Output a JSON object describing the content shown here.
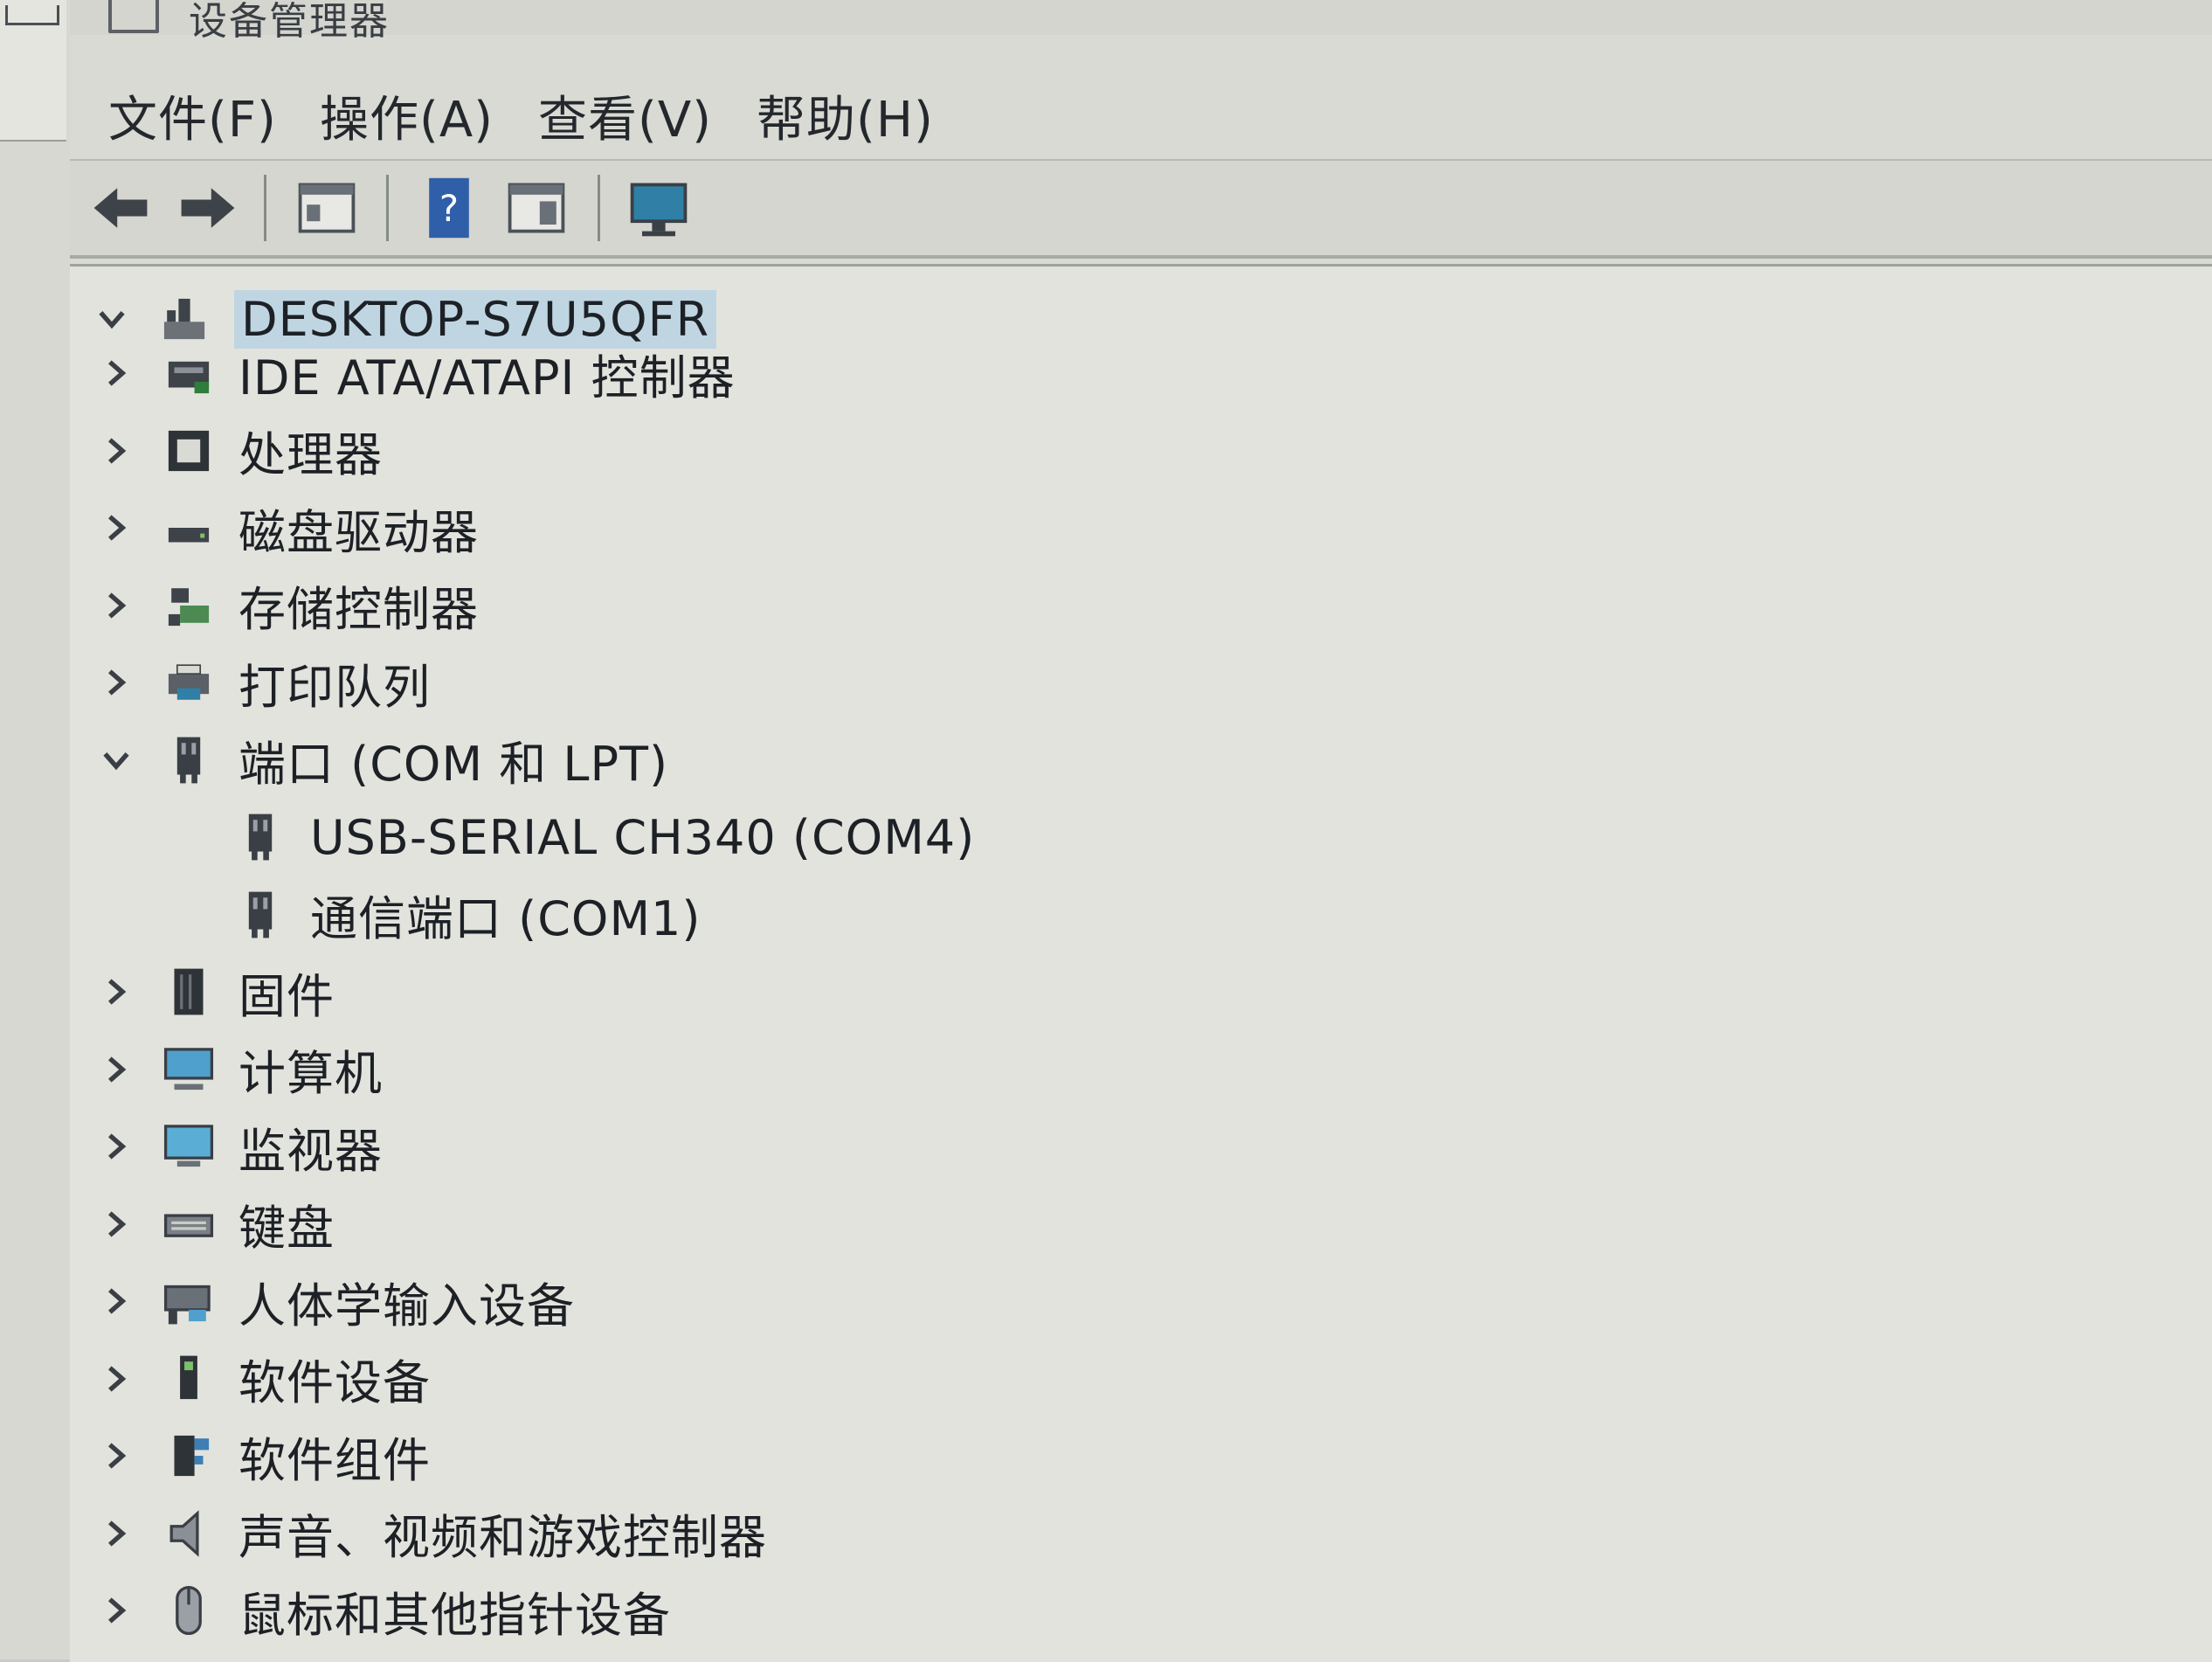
{
  "window": {
    "title": "设备管理器"
  },
  "menu": [
    "文件(F)",
    "操作(A)",
    "查看(V)",
    "帮助(H)"
  ],
  "toolbar": [
    "back-arrow-icon",
    "forward-arrow-icon",
    "properties-window-icon",
    "help-icon",
    "view-window-icon",
    "monitor-icon"
  ],
  "tree": {
    "root": "DESKTOP-S7U5QFR",
    "categories": [
      {
        "label": "IDE ATA/ATAPI 控制器",
        "icon": "ide-controller-icon",
        "expanded": false
      },
      {
        "label": "处理器",
        "icon": "processor-icon",
        "expanded": false
      },
      {
        "label": "磁盘驱动器",
        "icon": "disk-drive-icon",
        "expanded": false
      },
      {
        "label": "存储控制器",
        "icon": "storage-controller-icon",
        "expanded": false
      },
      {
        "label": "打印队列",
        "icon": "printer-icon",
        "expanded": false
      },
      {
        "label": "端口 (COM 和 LPT)",
        "icon": "port-icon",
        "expanded": true
      },
      {
        "label": "USB-SERIAL CH340 (COM4)",
        "icon": "port-icon",
        "child": true
      },
      {
        "label": "通信端口 (COM1)",
        "icon": "port-icon",
        "child": true
      },
      {
        "label": "固件",
        "icon": "firmware-icon",
        "expanded": false
      },
      {
        "label": "计算机",
        "icon": "computer-icon",
        "expanded": false
      },
      {
        "label": "监视器",
        "icon": "monitor-icon",
        "expanded": false
      },
      {
        "label": "键盘",
        "icon": "keyboard-icon",
        "expanded": false
      },
      {
        "label": "人体学输入设备",
        "icon": "hid-icon",
        "expanded": false
      },
      {
        "label": "软件设备",
        "icon": "software-device-icon",
        "expanded": false
      },
      {
        "label": "软件组件",
        "icon": "software-component-icon",
        "expanded": false
      },
      {
        "label": "声音、视频和游戏控制器",
        "icon": "speaker-icon",
        "expanded": false
      },
      {
        "label": "鼠标和其他指针设备",
        "icon": "mouse-icon",
        "expanded": false
      }
    ]
  }
}
